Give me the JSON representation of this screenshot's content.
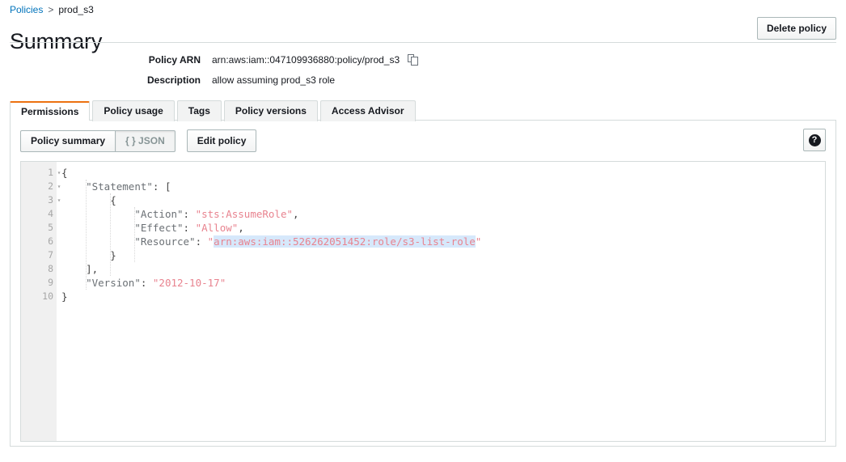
{
  "breadcrumb": {
    "root": "Policies",
    "separator": ">",
    "current": "prod_s3"
  },
  "header": {
    "title": "Summary",
    "delete_button": "Delete policy"
  },
  "details": [
    {
      "label": "Policy ARN",
      "value": "arn:aws:iam::047109936880:policy/prod_s3",
      "has_copy_icon": true
    },
    {
      "label": "Description",
      "value": "allow assuming prod_s3 role",
      "has_copy_icon": false
    }
  ],
  "tabs": [
    {
      "label": "Permissions",
      "active": true
    },
    {
      "label": "Policy usage",
      "active": false
    },
    {
      "label": "Tags",
      "active": false
    },
    {
      "label": "Policy versions",
      "active": false
    },
    {
      "label": "Access Advisor",
      "active": false
    }
  ],
  "toolbar": {
    "policy_summary_label": "Policy summary",
    "json_label": "{ } JSON",
    "edit_policy_label": "Edit policy",
    "help_glyph": "?"
  },
  "editor": {
    "line_numbers": [
      "1",
      "2",
      "3",
      "4",
      "5",
      "6",
      "7",
      "8",
      "9",
      "10"
    ],
    "fold_lines": [
      1,
      2,
      3
    ],
    "fold_glyph": "▾",
    "lines": [
      {
        "n": 1,
        "text": "{"
      },
      {
        "n": 2,
        "text": "    \"Statement\": ["
      },
      {
        "n": 3,
        "text": "        {"
      },
      {
        "n": 4,
        "text": "            \"Action\": \"sts:AssumeRole\","
      },
      {
        "n": 5,
        "text": "            \"Effect\": \"Allow\","
      },
      {
        "n": 6,
        "text": "            \"Resource\": \"arn:aws:iam::526262051452:role/s3-list-role\""
      },
      {
        "n": 7,
        "text": "        }"
      },
      {
        "n": 8,
        "text": "    ],"
      },
      {
        "n": 9,
        "text": "    \"Version\": \"2012-10-17\""
      },
      {
        "n": 10,
        "text": "}"
      }
    ],
    "selected_text": "arn:aws:iam::526262051452:role/s3-list-role",
    "json_document": {
      "Statement": [
        {
          "Action": "sts:AssumeRole",
          "Effect": "Allow",
          "Resource": "arn:aws:iam::526262051452:role/s3-list-role"
        }
      ],
      "Version": "2012-10-17"
    }
  },
  "colors": {
    "link": "#0073bb",
    "active_tab_accent": "#ec7211",
    "string_token": "#e8838f",
    "key_token": "#6b7075",
    "selection": "#d6e8fb",
    "border": "#d5dbdb"
  }
}
